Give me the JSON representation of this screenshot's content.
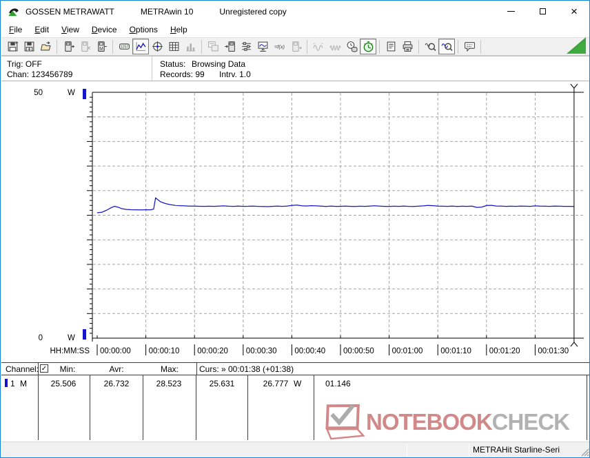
{
  "window": {
    "title_left": "GOSSEN METRAWATT",
    "title_mid": "METRAwin 10",
    "title_right": "Unregistered copy"
  },
  "menu": {
    "items": [
      {
        "label": "File",
        "u": 0
      },
      {
        "label": "Edit",
        "u": 0
      },
      {
        "label": "View",
        "u": 0
      },
      {
        "label": "Device",
        "u": 0
      },
      {
        "label": "Options",
        "u": 0
      },
      {
        "label": "Help",
        "u": 0
      }
    ]
  },
  "toolbar": {
    "items": [
      {
        "icon": "save-disk-icon",
        "state": "normal"
      },
      {
        "icon": "save-channels-icon",
        "state": "normal"
      },
      {
        "icon": "open-folder-icon",
        "state": "normal"
      },
      {
        "icon": "separator"
      },
      {
        "icon": "device-read-icon",
        "state": "normal"
      },
      {
        "icon": "device-clear-icon",
        "state": "disabled"
      },
      {
        "icon": "device-memory-icon",
        "state": "normal"
      },
      {
        "icon": "separator"
      },
      {
        "icon": "lcd-display-icon",
        "state": "normal"
      },
      {
        "icon": "line-chart-icon",
        "state": "pressed"
      },
      {
        "icon": "crosshair-chart-icon",
        "state": "normal"
      },
      {
        "icon": "table-view-icon",
        "state": "normal"
      },
      {
        "icon": "bar-graph-icon",
        "state": "disabled"
      },
      {
        "icon": "separator"
      },
      {
        "icon": "window-export-icon",
        "state": "disabled"
      },
      {
        "icon": "device-import-icon",
        "state": "normal"
      },
      {
        "icon": "channel-settings-icon",
        "state": "normal"
      },
      {
        "icon": "monitor-icon",
        "state": "normal"
      },
      {
        "icon": "formula-fx-icon",
        "state": "normal"
      },
      {
        "icon": "device-transfer-icon",
        "state": "disabled"
      },
      {
        "icon": "separator"
      },
      {
        "icon": "wave-coarse-icon",
        "state": "disabled"
      },
      {
        "icon": "wave-fine-icon",
        "state": "disabled"
      },
      {
        "icon": "clock-database-icon",
        "state": "normal"
      },
      {
        "icon": "timer-green-icon",
        "state": "pressed"
      },
      {
        "icon": "separator"
      },
      {
        "icon": "print-preview-icon",
        "state": "normal"
      },
      {
        "icon": "printer-icon",
        "state": "normal"
      },
      {
        "icon": "separator"
      },
      {
        "icon": "zoom-out-icon",
        "state": "normal"
      },
      {
        "icon": "zoom-window-icon",
        "state": "pressed"
      },
      {
        "icon": "separator"
      },
      {
        "icon": "comment-bubble-icon",
        "state": "normal"
      },
      {
        "icon": "separator"
      }
    ],
    "corner_triangle_color": "#3aa43a"
  },
  "status_panel": {
    "trig": "Trig: OFF",
    "chan": "Chan: 123456789",
    "status_label": "Status:",
    "status_value": "Browsing Data",
    "records": "Records: 99",
    "interval": "Intrv. 1.0"
  },
  "chart_data": {
    "type": "line",
    "title": "",
    "xlabel": "HH:MM:SS",
    "ylabel": "W",
    "ylim": [
      0,
      50
    ],
    "y_major_step": 5,
    "y_minor_step": 1,
    "y_axis_labels": [
      {
        "value": 50,
        "text": "50",
        "unit": "W"
      },
      {
        "value": 0,
        "text": "0",
        "unit": "W"
      }
    ],
    "x_ticks_seconds": [
      0,
      10,
      20,
      30,
      40,
      50,
      60,
      70,
      80,
      90
    ],
    "x_tick_labels": [
      "00:00:00",
      "00:00:10",
      "00:00:20",
      "00:00:30",
      "00:00:40",
      "00:00:50",
      "00:01:00",
      "00:01:10",
      "00:01:20",
      "00:01:30"
    ],
    "grid": "dashed",
    "legend_position": "none",
    "cursor": {
      "time_seconds": 98,
      "label": "00:01:38"
    },
    "series": [
      {
        "name": "Channel 1",
        "color": "#1414c8",
        "unit": "W",
        "points": [
          [
            0,
            25.5
          ],
          [
            1,
            25.62
          ],
          [
            2,
            26.05
          ],
          [
            3,
            26.6
          ],
          [
            3.6,
            26.82
          ],
          [
            4.4,
            26.6
          ],
          [
            5,
            26.35
          ],
          [
            6,
            26.18
          ],
          [
            7,
            26.12
          ],
          [
            8,
            26.1
          ],
          [
            9,
            26.08
          ],
          [
            10,
            26.12
          ],
          [
            11,
            26.1
          ],
          [
            11.6,
            26.25
          ],
          [
            12,
            28.52
          ],
          [
            12.6,
            28.05
          ],
          [
            13,
            27.75
          ],
          [
            14,
            27.38
          ],
          [
            15,
            27.15
          ],
          [
            16,
            27.02
          ],
          [
            17,
            26.95
          ],
          [
            18,
            26.9
          ],
          [
            19,
            26.86
          ],
          [
            20,
            26.85
          ],
          [
            21,
            26.82
          ],
          [
            22,
            26.8
          ],
          [
            23,
            26.84
          ],
          [
            24,
            26.8
          ],
          [
            25,
            26.86
          ],
          [
            26,
            26.9
          ],
          [
            27,
            26.84
          ],
          [
            28,
            26.8
          ],
          [
            29,
            26.85
          ],
          [
            30,
            26.8
          ],
          [
            31,
            26.82
          ],
          [
            32,
            26.86
          ],
          [
            33,
            26.8
          ],
          [
            34,
            26.78
          ],
          [
            35,
            26.75
          ],
          [
            36,
            26.8
          ],
          [
            37,
            26.85
          ],
          [
            38,
            26.8
          ],
          [
            39,
            26.86
          ],
          [
            40,
            27.0
          ],
          [
            41,
            27.06
          ],
          [
            42,
            26.92
          ],
          [
            43,
            26.88
          ],
          [
            44,
            26.95
          ],
          [
            45,
            26.9
          ],
          [
            46,
            26.85
          ],
          [
            47,
            26.78
          ],
          [
            48,
            26.85
          ],
          [
            49,
            26.8
          ],
          [
            50,
            26.8
          ],
          [
            51,
            26.85
          ],
          [
            52,
            26.8
          ],
          [
            53,
            26.78
          ],
          [
            54,
            26.84
          ],
          [
            55,
            26.8
          ],
          [
            56,
            26.86
          ],
          [
            57,
            26.92
          ],
          [
            58,
            26.85
          ],
          [
            59,
            26.8
          ],
          [
            60,
            26.78
          ],
          [
            61,
            26.84
          ],
          [
            62,
            26.8
          ],
          [
            63,
            26.86
          ],
          [
            64,
            26.8
          ],
          [
            65,
            26.78
          ],
          [
            66,
            26.84
          ],
          [
            67,
            26.9
          ],
          [
            68,
            27.0
          ],
          [
            69,
            26.94
          ],
          [
            70,
            26.85
          ],
          [
            71,
            26.84
          ],
          [
            72,
            26.8
          ],
          [
            73,
            26.85
          ],
          [
            74,
            26.78
          ],
          [
            75,
            26.84
          ],
          [
            76,
            26.8
          ],
          [
            77,
            26.85
          ],
          [
            78,
            26.6
          ],
          [
            79,
            26.65
          ],
          [
            80,
            26.98
          ],
          [
            81,
            27.02
          ],
          [
            82,
            26.88
          ],
          [
            83,
            26.85
          ],
          [
            84,
            26.8
          ],
          [
            85,
            26.84
          ],
          [
            86,
            26.8
          ],
          [
            87,
            26.85
          ],
          [
            88,
            26.84
          ],
          [
            89,
            26.8
          ],
          [
            90,
            26.9
          ],
          [
            91,
            26.85
          ],
          [
            92,
            26.84
          ],
          [
            93,
            26.8
          ],
          [
            94,
            26.85
          ],
          [
            95,
            26.84
          ],
          [
            96,
            26.8
          ],
          [
            97,
            26.8
          ],
          [
            98,
            26.78
          ]
        ]
      }
    ]
  },
  "table": {
    "header": {
      "channel": "Channel:",
      "checkbox_checked": true,
      "min": "Min:",
      "avr": "Avr:",
      "max": "Max:",
      "cursor": "Curs: » 00:01:38 (+01:38)"
    },
    "rows": [
      {
        "channel": "1",
        "mode": "M",
        "color": "#1414c8",
        "min": "25.506",
        "avr": "26.732",
        "max": "28.523",
        "cursor_a": "25.631",
        "cursor_b": "26.777",
        "unit": "W",
        "delta": "01.146"
      }
    ]
  },
  "watermark": {
    "text_primary": "NOTEBOOK",
    "text_secondary": "CHECK",
    "color_primary": "#c96f6e",
    "color_secondary": "#a2a2a2"
  },
  "statusbar": {
    "device": "METRAHit Starline-Seri"
  }
}
